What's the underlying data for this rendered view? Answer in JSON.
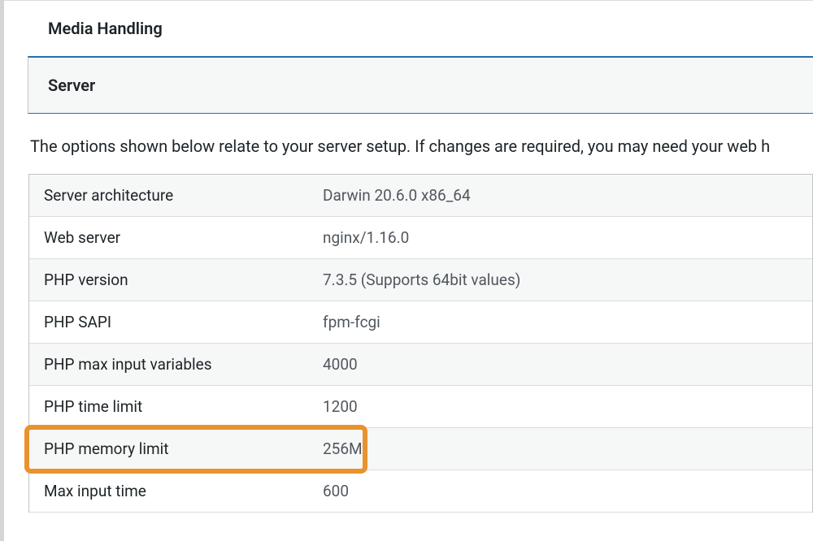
{
  "sections": {
    "media_handling": "Media Handling",
    "server": "Server"
  },
  "description": "The options shown below relate to your server setup. If changes are required, you may need your web h",
  "server_info": [
    {
      "label": "Server architecture",
      "value": "Darwin 20.6.0 x86_64"
    },
    {
      "label": "Web server",
      "value": "nginx/1.16.0"
    },
    {
      "label": "PHP version",
      "value": "7.3.5 (Supports 64bit values)"
    },
    {
      "label": "PHP SAPI",
      "value": "fpm-fcgi"
    },
    {
      "label": "PHP max input variables",
      "value": "4000"
    },
    {
      "label": "PHP time limit",
      "value": "1200"
    },
    {
      "label": "PHP memory limit",
      "value": "256M"
    },
    {
      "label": "Max input time",
      "value": "600"
    }
  ],
  "highlight": {
    "row_index": 6
  }
}
